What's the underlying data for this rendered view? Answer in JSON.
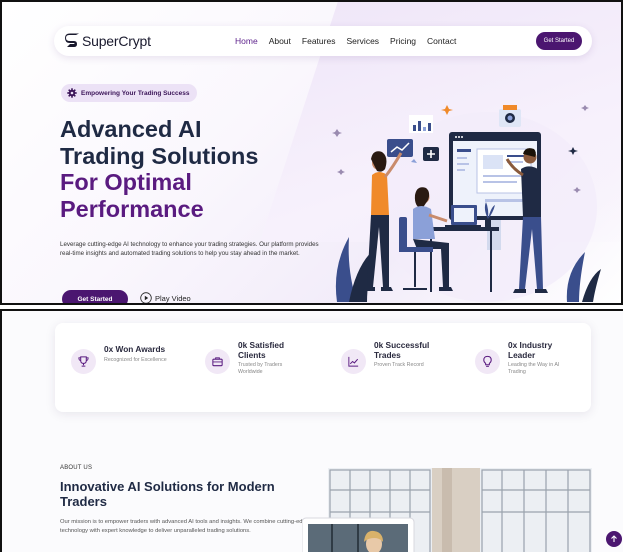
{
  "nav": {
    "brand": "SuperCrypt",
    "links": [
      "Home",
      "About",
      "Features",
      "Services",
      "Pricing",
      "Contact"
    ],
    "cta": "Get Started"
  },
  "hero": {
    "badge": "Empowering Your Trading Success",
    "title_lines": [
      "Advanced AI",
      "Trading Solutions",
      "For Optimal",
      "Performance"
    ],
    "description": "Leverage cutting-edge AI technology to enhance your trading strategies. Our platform provides real-time insights and automated trading solutions to help you stay ahead in the market.",
    "cta": "Get Started",
    "play": "Play Video"
  },
  "stats": [
    {
      "title": "0x Won Awards",
      "sub": "Recognized for Excellence",
      "icon": "trophy-icon"
    },
    {
      "title": "0k Satisfied Clients",
      "sub": "Trusted by Traders Worldwide",
      "icon": "briefcase-icon"
    },
    {
      "title": "0k Successful Trades",
      "sub": "Proven Track Record",
      "icon": "chart-line-icon"
    },
    {
      "title": "0x Industry Leader",
      "sub": "Leading the Way in AI Trading",
      "icon": "lightbulb-icon"
    }
  ],
  "about": {
    "label": "ABOUT US",
    "title": "Innovative AI Solutions for Modern Traders",
    "description": "Our mission is to empower traders with advanced AI tools and insights. We combine cutting-edge technology with expert knowledge to deliver unparalleled trading solutions."
  },
  "colors": {
    "primary": "#4b1670",
    "accent_purple": "#5a1b80",
    "heading_dark": "#1f2a44",
    "badge_bg": "#ece2f6"
  }
}
